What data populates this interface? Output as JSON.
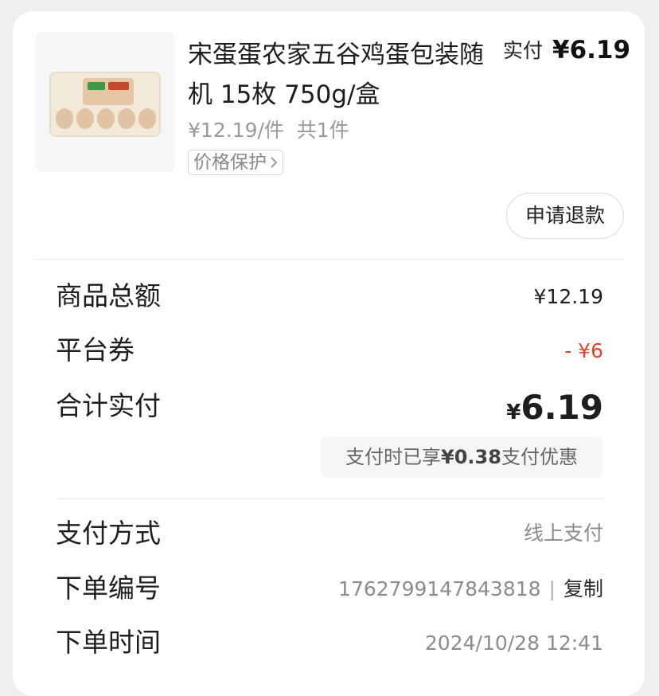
{
  "product": {
    "image_icon": "egg-tray-thumbnail",
    "title": "宋蛋蛋农家五谷鸡蛋包装随机 15枚 750g/盒",
    "paid_prefix": "实付",
    "paid_amount": "¥6.19",
    "unit_price": "¥12.19/件  共1件",
    "price_protect_label": "价格保护",
    "price_protect_chevron": "chevron-right-icon",
    "refund_button": "申请退款"
  },
  "summary": {
    "goods_total_label": "商品总额",
    "goods_total_value": "¥12.19",
    "coupon_label": "平台券",
    "coupon_value": "- ¥6",
    "total_label": "合计实付",
    "total_currency": "¥",
    "total_value": "6.19",
    "saving_prefix": "支付时已享",
    "saving_amount": "¥0.38",
    "saving_suffix": "支付优惠"
  },
  "order": {
    "payment_method_label": "支付方式",
    "payment_method_value": "线上支付",
    "order_no_label": "下单编号",
    "order_no_value": "1762799147843818",
    "copy_label": "复制",
    "order_time_label": "下单时间",
    "order_time_value": "2024/10/28 12:41"
  },
  "colors": {
    "coupon_red": "#e2432b",
    "background": "#efefef"
  }
}
